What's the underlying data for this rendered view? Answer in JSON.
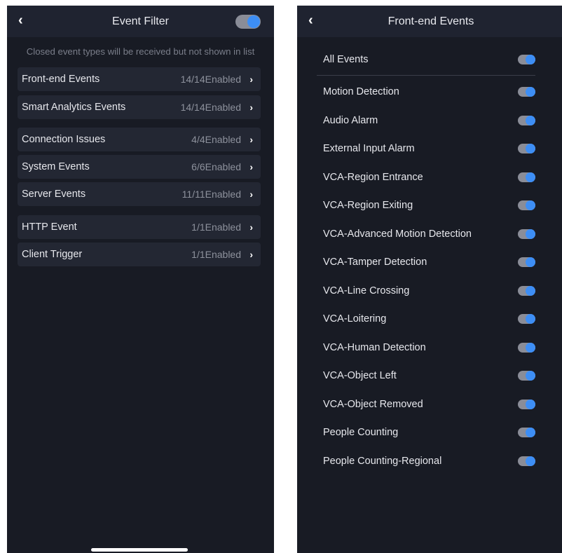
{
  "left_panel": {
    "title": "Event Filter",
    "hint": "Closed event types will be received but not shown in list",
    "groups": [
      {
        "label": "Front-end Events",
        "value": "14/14Enabled"
      },
      {
        "label": "Smart Analytics Events",
        "value": "14/14Enabled"
      },
      {
        "label": "Connection Issues",
        "value": "4/4Enabled"
      },
      {
        "label": "System Events",
        "value": "6/6Enabled"
      },
      {
        "label": "Server Events",
        "value": "11/11Enabled"
      },
      {
        "label": "HTTP Event",
        "value": "1/1Enabled"
      },
      {
        "label": "Client Trigger",
        "value": "1/1Enabled"
      }
    ],
    "toggle_on": true,
    "chevron": "›"
  },
  "right_panel": {
    "title": "Front-end Events",
    "all_events_label": "All Events",
    "events": [
      {
        "label": "Motion Detection",
        "on": true
      },
      {
        "label": "Audio Alarm",
        "on": true
      },
      {
        "label": "External Input Alarm",
        "on": true
      },
      {
        "label": "VCA-Region Entrance",
        "on": true
      },
      {
        "label": "VCA-Region Exiting",
        "on": true
      },
      {
        "label": "VCA-Advanced Motion Detection",
        "on": true
      },
      {
        "label": "VCA-Tamper Detection",
        "on": true
      },
      {
        "label": "VCA-Line Crossing",
        "on": true
      },
      {
        "label": "VCA-Loitering",
        "on": true
      },
      {
        "label": "VCA-Human Detection",
        "on": true
      },
      {
        "label": "VCA-Object Left",
        "on": true
      },
      {
        "label": "VCA-Object Removed",
        "on": true
      },
      {
        "label": "People Counting",
        "on": true
      },
      {
        "label": "People Counting-Regional",
        "on": true
      }
    ]
  },
  "icons": {
    "back": "‹",
    "toggle": "toggle-switch-icon"
  },
  "colors": {
    "background": "#181b24",
    "navbar": "#1f2330",
    "row": "#232733",
    "accent": "#3d8ef5",
    "toggle_track": "#8a8d98"
  }
}
